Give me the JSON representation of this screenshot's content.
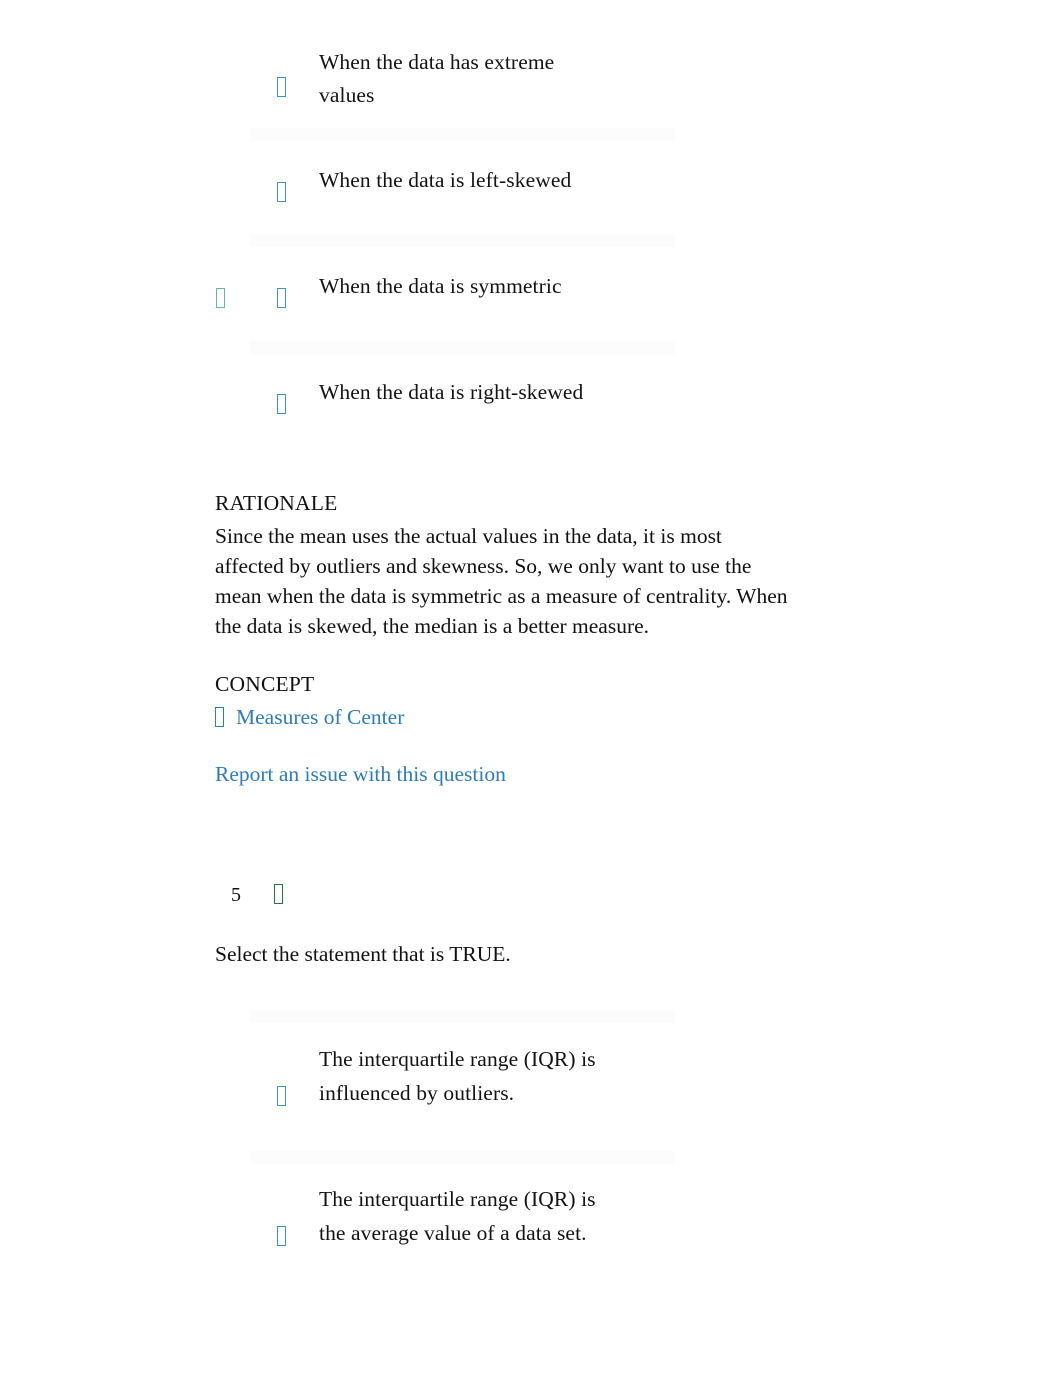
{
  "document": {
    "kind": "quiz-review-page",
    "link_color": "#2c7cb8",
    "radio_color": "#3f92c9",
    "correct_color": "#66b898",
    "flag_color": "#22734d",
    "divider_color": "#fcfcfd",
    "text_color": "#111111"
  },
  "question_4": {
    "options": [
      {
        "text_line_1": "When the data has extreme",
        "text_line_2": "values",
        "radio_icon": "radio-button-unselected-icon",
        "correct_icon": null
      },
      {
        "text_line_1": "When the data is left-skewed",
        "text_line_2": "",
        "radio_icon": "radio-button-unselected-icon",
        "correct_icon": null
      },
      {
        "text_line_1": "When the data is symmetric",
        "text_line_2": "",
        "radio_icon": "radio-button-selected-icon",
        "correct_icon": "correct-answer-check-icon"
      },
      {
        "text_line_1": "When the data is right-skewed",
        "text_line_2": "",
        "radio_icon": "radio-button-unselected-icon",
        "correct_icon": null
      }
    ],
    "rationale": {
      "heading": "RATIONALE",
      "lines": [
        "Since the mean uses the actual values in the data, it is most",
        "affected by outliers and skewness. So, we only want to use the",
        "mean when the data is symmetric as a measure of centrality. When",
        "the data is skewed, the median is a better measure."
      ]
    },
    "concept": {
      "heading": "CONCEPT",
      "icon": "concept-bookmark-icon",
      "link_label": "Measures of Center"
    },
    "report_link": "Report an issue with this question"
  },
  "question_5": {
    "number": "5",
    "status_icon": "question-status-flag-icon",
    "prompt": "Select the statement that is TRUE.",
    "options": [
      {
        "text_line_1": "The interquartile range (IQR) is",
        "text_line_2": "influenced by outliers.",
        "radio_icon": "radio-button-unselected-icon",
        "correct_icon": null
      },
      {
        "text_line_1": "The interquartile range (IQR) is",
        "text_line_2": "the average value of a data set.",
        "radio_icon": "radio-button-unselected-icon",
        "correct_icon": null
      }
    ]
  }
}
